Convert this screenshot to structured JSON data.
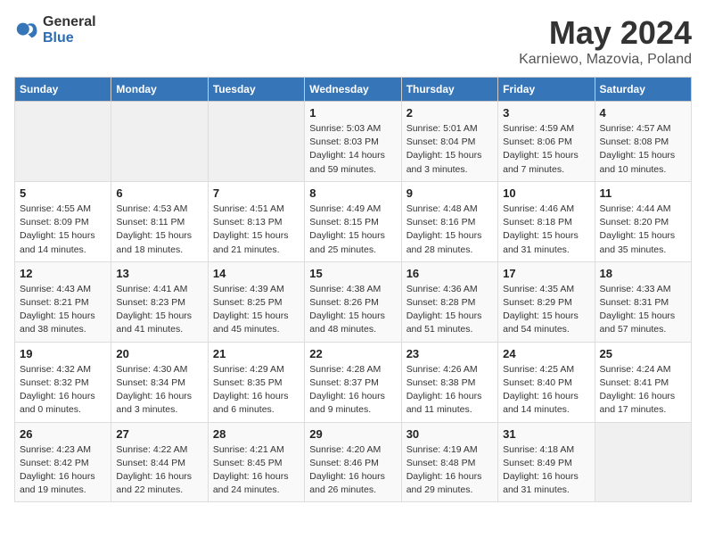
{
  "header": {
    "logo_general": "General",
    "logo_blue": "Blue",
    "title": "May 2024",
    "subtitle": "Karniewo, Mazovia, Poland"
  },
  "weekdays": [
    "Sunday",
    "Monday",
    "Tuesday",
    "Wednesday",
    "Thursday",
    "Friday",
    "Saturday"
  ],
  "weeks": [
    [
      {
        "day": "",
        "info": ""
      },
      {
        "day": "",
        "info": ""
      },
      {
        "day": "",
        "info": ""
      },
      {
        "day": "1",
        "info": "Sunrise: 5:03 AM\nSunset: 8:03 PM\nDaylight: 14 hours\nand 59 minutes."
      },
      {
        "day": "2",
        "info": "Sunrise: 5:01 AM\nSunset: 8:04 PM\nDaylight: 15 hours\nand 3 minutes."
      },
      {
        "day": "3",
        "info": "Sunrise: 4:59 AM\nSunset: 8:06 PM\nDaylight: 15 hours\nand 7 minutes."
      },
      {
        "day": "4",
        "info": "Sunrise: 4:57 AM\nSunset: 8:08 PM\nDaylight: 15 hours\nand 10 minutes."
      }
    ],
    [
      {
        "day": "5",
        "info": "Sunrise: 4:55 AM\nSunset: 8:09 PM\nDaylight: 15 hours\nand 14 minutes."
      },
      {
        "day": "6",
        "info": "Sunrise: 4:53 AM\nSunset: 8:11 PM\nDaylight: 15 hours\nand 18 minutes."
      },
      {
        "day": "7",
        "info": "Sunrise: 4:51 AM\nSunset: 8:13 PM\nDaylight: 15 hours\nand 21 minutes."
      },
      {
        "day": "8",
        "info": "Sunrise: 4:49 AM\nSunset: 8:15 PM\nDaylight: 15 hours\nand 25 minutes."
      },
      {
        "day": "9",
        "info": "Sunrise: 4:48 AM\nSunset: 8:16 PM\nDaylight: 15 hours\nand 28 minutes."
      },
      {
        "day": "10",
        "info": "Sunrise: 4:46 AM\nSunset: 8:18 PM\nDaylight: 15 hours\nand 31 minutes."
      },
      {
        "day": "11",
        "info": "Sunrise: 4:44 AM\nSunset: 8:20 PM\nDaylight: 15 hours\nand 35 minutes."
      }
    ],
    [
      {
        "day": "12",
        "info": "Sunrise: 4:43 AM\nSunset: 8:21 PM\nDaylight: 15 hours\nand 38 minutes."
      },
      {
        "day": "13",
        "info": "Sunrise: 4:41 AM\nSunset: 8:23 PM\nDaylight: 15 hours\nand 41 minutes."
      },
      {
        "day": "14",
        "info": "Sunrise: 4:39 AM\nSunset: 8:25 PM\nDaylight: 15 hours\nand 45 minutes."
      },
      {
        "day": "15",
        "info": "Sunrise: 4:38 AM\nSunset: 8:26 PM\nDaylight: 15 hours\nand 48 minutes."
      },
      {
        "day": "16",
        "info": "Sunrise: 4:36 AM\nSunset: 8:28 PM\nDaylight: 15 hours\nand 51 minutes."
      },
      {
        "day": "17",
        "info": "Sunrise: 4:35 AM\nSunset: 8:29 PM\nDaylight: 15 hours\nand 54 minutes."
      },
      {
        "day": "18",
        "info": "Sunrise: 4:33 AM\nSunset: 8:31 PM\nDaylight: 15 hours\nand 57 minutes."
      }
    ],
    [
      {
        "day": "19",
        "info": "Sunrise: 4:32 AM\nSunset: 8:32 PM\nDaylight: 16 hours\nand 0 minutes."
      },
      {
        "day": "20",
        "info": "Sunrise: 4:30 AM\nSunset: 8:34 PM\nDaylight: 16 hours\nand 3 minutes."
      },
      {
        "day": "21",
        "info": "Sunrise: 4:29 AM\nSunset: 8:35 PM\nDaylight: 16 hours\nand 6 minutes."
      },
      {
        "day": "22",
        "info": "Sunrise: 4:28 AM\nSunset: 8:37 PM\nDaylight: 16 hours\nand 9 minutes."
      },
      {
        "day": "23",
        "info": "Sunrise: 4:26 AM\nSunset: 8:38 PM\nDaylight: 16 hours\nand 11 minutes."
      },
      {
        "day": "24",
        "info": "Sunrise: 4:25 AM\nSunset: 8:40 PM\nDaylight: 16 hours\nand 14 minutes."
      },
      {
        "day": "25",
        "info": "Sunrise: 4:24 AM\nSunset: 8:41 PM\nDaylight: 16 hours\nand 17 minutes."
      }
    ],
    [
      {
        "day": "26",
        "info": "Sunrise: 4:23 AM\nSunset: 8:42 PM\nDaylight: 16 hours\nand 19 minutes."
      },
      {
        "day": "27",
        "info": "Sunrise: 4:22 AM\nSunset: 8:44 PM\nDaylight: 16 hours\nand 22 minutes."
      },
      {
        "day": "28",
        "info": "Sunrise: 4:21 AM\nSunset: 8:45 PM\nDaylight: 16 hours\nand 24 minutes."
      },
      {
        "day": "29",
        "info": "Sunrise: 4:20 AM\nSunset: 8:46 PM\nDaylight: 16 hours\nand 26 minutes."
      },
      {
        "day": "30",
        "info": "Sunrise: 4:19 AM\nSunset: 8:48 PM\nDaylight: 16 hours\nand 29 minutes."
      },
      {
        "day": "31",
        "info": "Sunrise: 4:18 AM\nSunset: 8:49 PM\nDaylight: 16 hours\nand 31 minutes."
      },
      {
        "day": "",
        "info": ""
      }
    ]
  ]
}
